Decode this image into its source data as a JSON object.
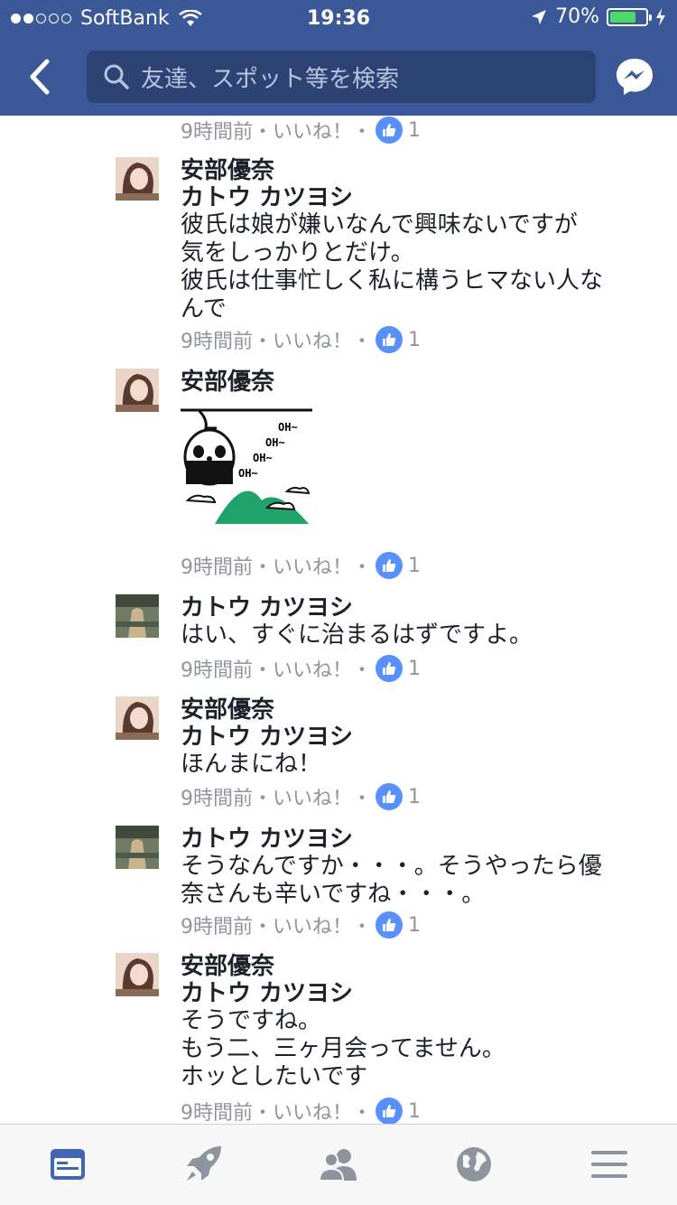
{
  "status_bar": {
    "carrier": "SoftBank",
    "time": "19:36",
    "battery": "70%"
  },
  "nav": {
    "search_placeholder": "友達、スポット等を検索"
  },
  "colors": {
    "brand": "#3b5998",
    "like_badge": "#5890ff",
    "active_tab": "#4267b2",
    "inactive_tab": "#8d949e"
  },
  "top_meta": {
    "time": "9時間前",
    "like": "いいね！",
    "count": "1"
  },
  "comments": [
    {
      "author": "安部優奈",
      "reply_to": "カトウ カツヨシ",
      "text": "彼氏は娘が嫌いなんで興味ないですが\n気をしっかりとだけ。\n彼氏は仕事忙しく私に構うヒマない人な\nんで",
      "time": "9時間前",
      "like": "いいね！",
      "count": "1"
    },
    {
      "author": "安部優奈",
      "sticker": {
        "label_1": "OH~",
        "label_2": "OH~",
        "label_3": "OH~",
        "label_4": "OH~"
      },
      "time": "9時間前",
      "like": "いいね！",
      "count": "1"
    },
    {
      "author": "カトウ カツヨシ",
      "text": "はい、すぐに治まるはずですよ。",
      "time": "9時間前",
      "like": "いいね！",
      "count": "1"
    },
    {
      "author": "安部優奈",
      "reply_to": "カトウ カツヨシ",
      "text": "ほんまにね！",
      "time": "9時間前",
      "like": "いいね！",
      "count": "1"
    },
    {
      "author": "カトウ カツヨシ",
      "text": "そうなんですか・・・。そうやったら優\n奈さんも辛いですね・・・。",
      "time": "9時間前",
      "like": "いいね！",
      "count": "1"
    },
    {
      "author": "安部優奈",
      "reply_to": "カトウ カツヨシ",
      "text": "そうですね。\nもう二、三ヶ月会ってません。\nホッとしたいです",
      "time": "9時間前",
      "like": "いいね！",
      "count": "1"
    }
  ],
  "tabs": [
    {
      "icon": "news-feed-icon",
      "active": true
    },
    {
      "icon": "rocket-icon",
      "active": false
    },
    {
      "icon": "friends-icon",
      "active": false
    },
    {
      "icon": "globe-icon",
      "active": false
    },
    {
      "icon": "menu-icon",
      "active": false
    }
  ]
}
